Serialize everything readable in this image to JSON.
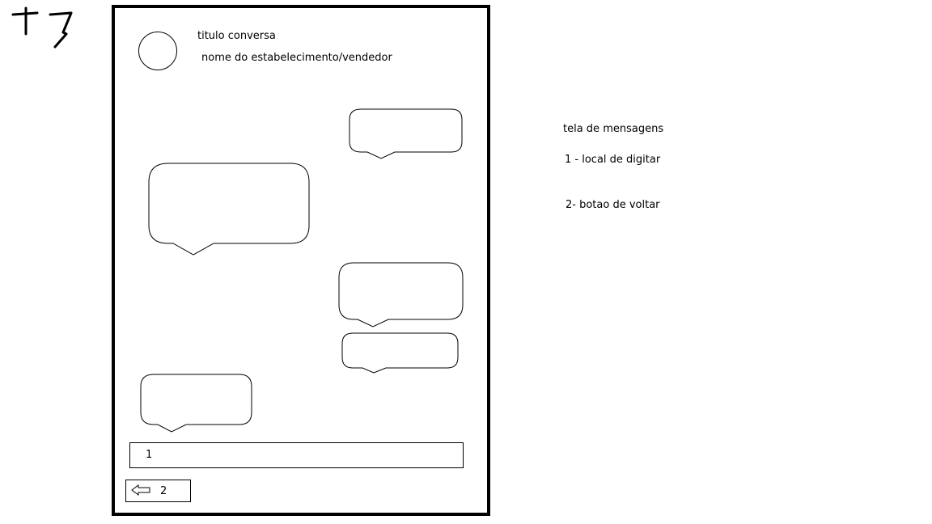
{
  "sketch_mark": "T7",
  "header": {
    "title": "titulo conversa",
    "subtitle": "nome do estabelecimento/vendedor"
  },
  "input": {
    "label": "1"
  },
  "back_button": {
    "label": "2",
    "icon": "back-arrow-icon"
  },
  "legend": {
    "title": "tela de mensagens",
    "items": [
      "1 - local de digitar",
      "2- botao de voltar"
    ]
  },
  "colors": {
    "stroke": "#000000",
    "background": "#ffffff"
  }
}
